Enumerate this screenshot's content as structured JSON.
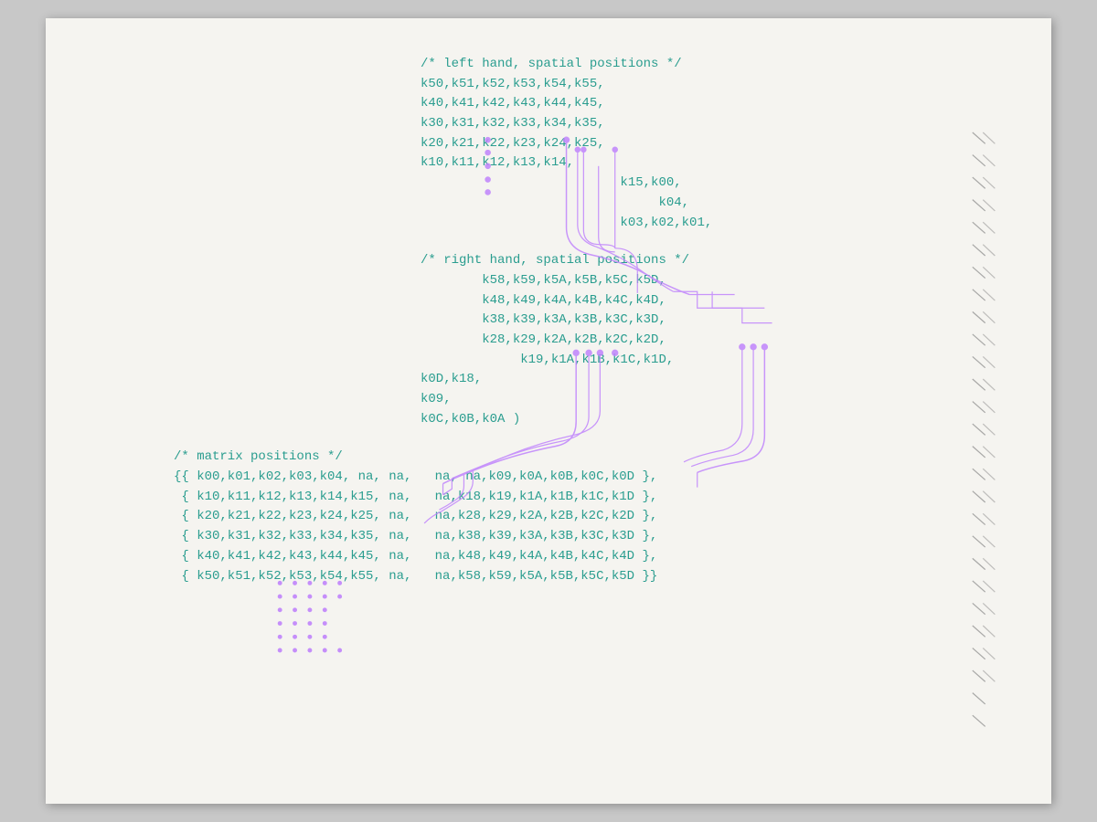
{
  "page": {
    "background": "#f5f4f0",
    "accent_color": "#c084fc",
    "code_color": "#2a9d8f",
    "left_hand_comment": "/* left hand, spatial positions */",
    "left_hand_rows": [
      "k50,k51,k52,k53,k54,k55,",
      "k40,k41,k42,k43,k44,k45,",
      "k30,k31,k32,k33,k34,k35,",
      "k20,k21,k22,k23,k24,k25,",
      "k10,k11,k12,k13,k14,"
    ],
    "left_hand_extra": [
      "                          k15,k00,",
      "                               k04,",
      "                          k03,k02,k01,"
    ],
    "right_hand_comment": "/* right hand, spatial positions */",
    "right_hand_rows": [
      "        k58,k59,k5A,k5B,k5C,k5D,",
      "        k48,k49,k4A,k4B,k4C,k4D,",
      "        k38,k39,k3A,k3B,k3C,k3D,",
      "        k28,k29,k2A,k2B,k2C,k2D,",
      "             k19,k1A,k1B,k1C,k1D,"
    ],
    "right_hand_extra": [
      "k0D,k18,",
      "k09,",
      "k0C,k0B,k0A )"
    ],
    "matrix_comment": "/* matrix positions */",
    "matrix_rows": [
      "{{ k00,k01,k02,k03,k04, na, na,   na, na,k09,k0A,k0B,k0C,k0D },",
      " { k10,k11,k12,k13,k14,k15, na,   na,k18,k19,k1A,k1B,k1C,k1D },",
      " { k20,k21,k22,k23,k24,k25, na,   na,k28,k29,k2A,k2B,k2C,k2D },",
      " { k30,k31,k32,k33,k34,k35, na,   na,k38,k39,k3A,k3B,k3C,k3D },",
      " { k40,k41,k42,k43,k44,k45, na,   na,k48,k49,k4A,k4B,k4C,k4D },",
      " { k50,k51,k52,k53,k54,k55, na,   na,k58,k59,k5A,k5B,k5C,k5D }}"
    ]
  }
}
